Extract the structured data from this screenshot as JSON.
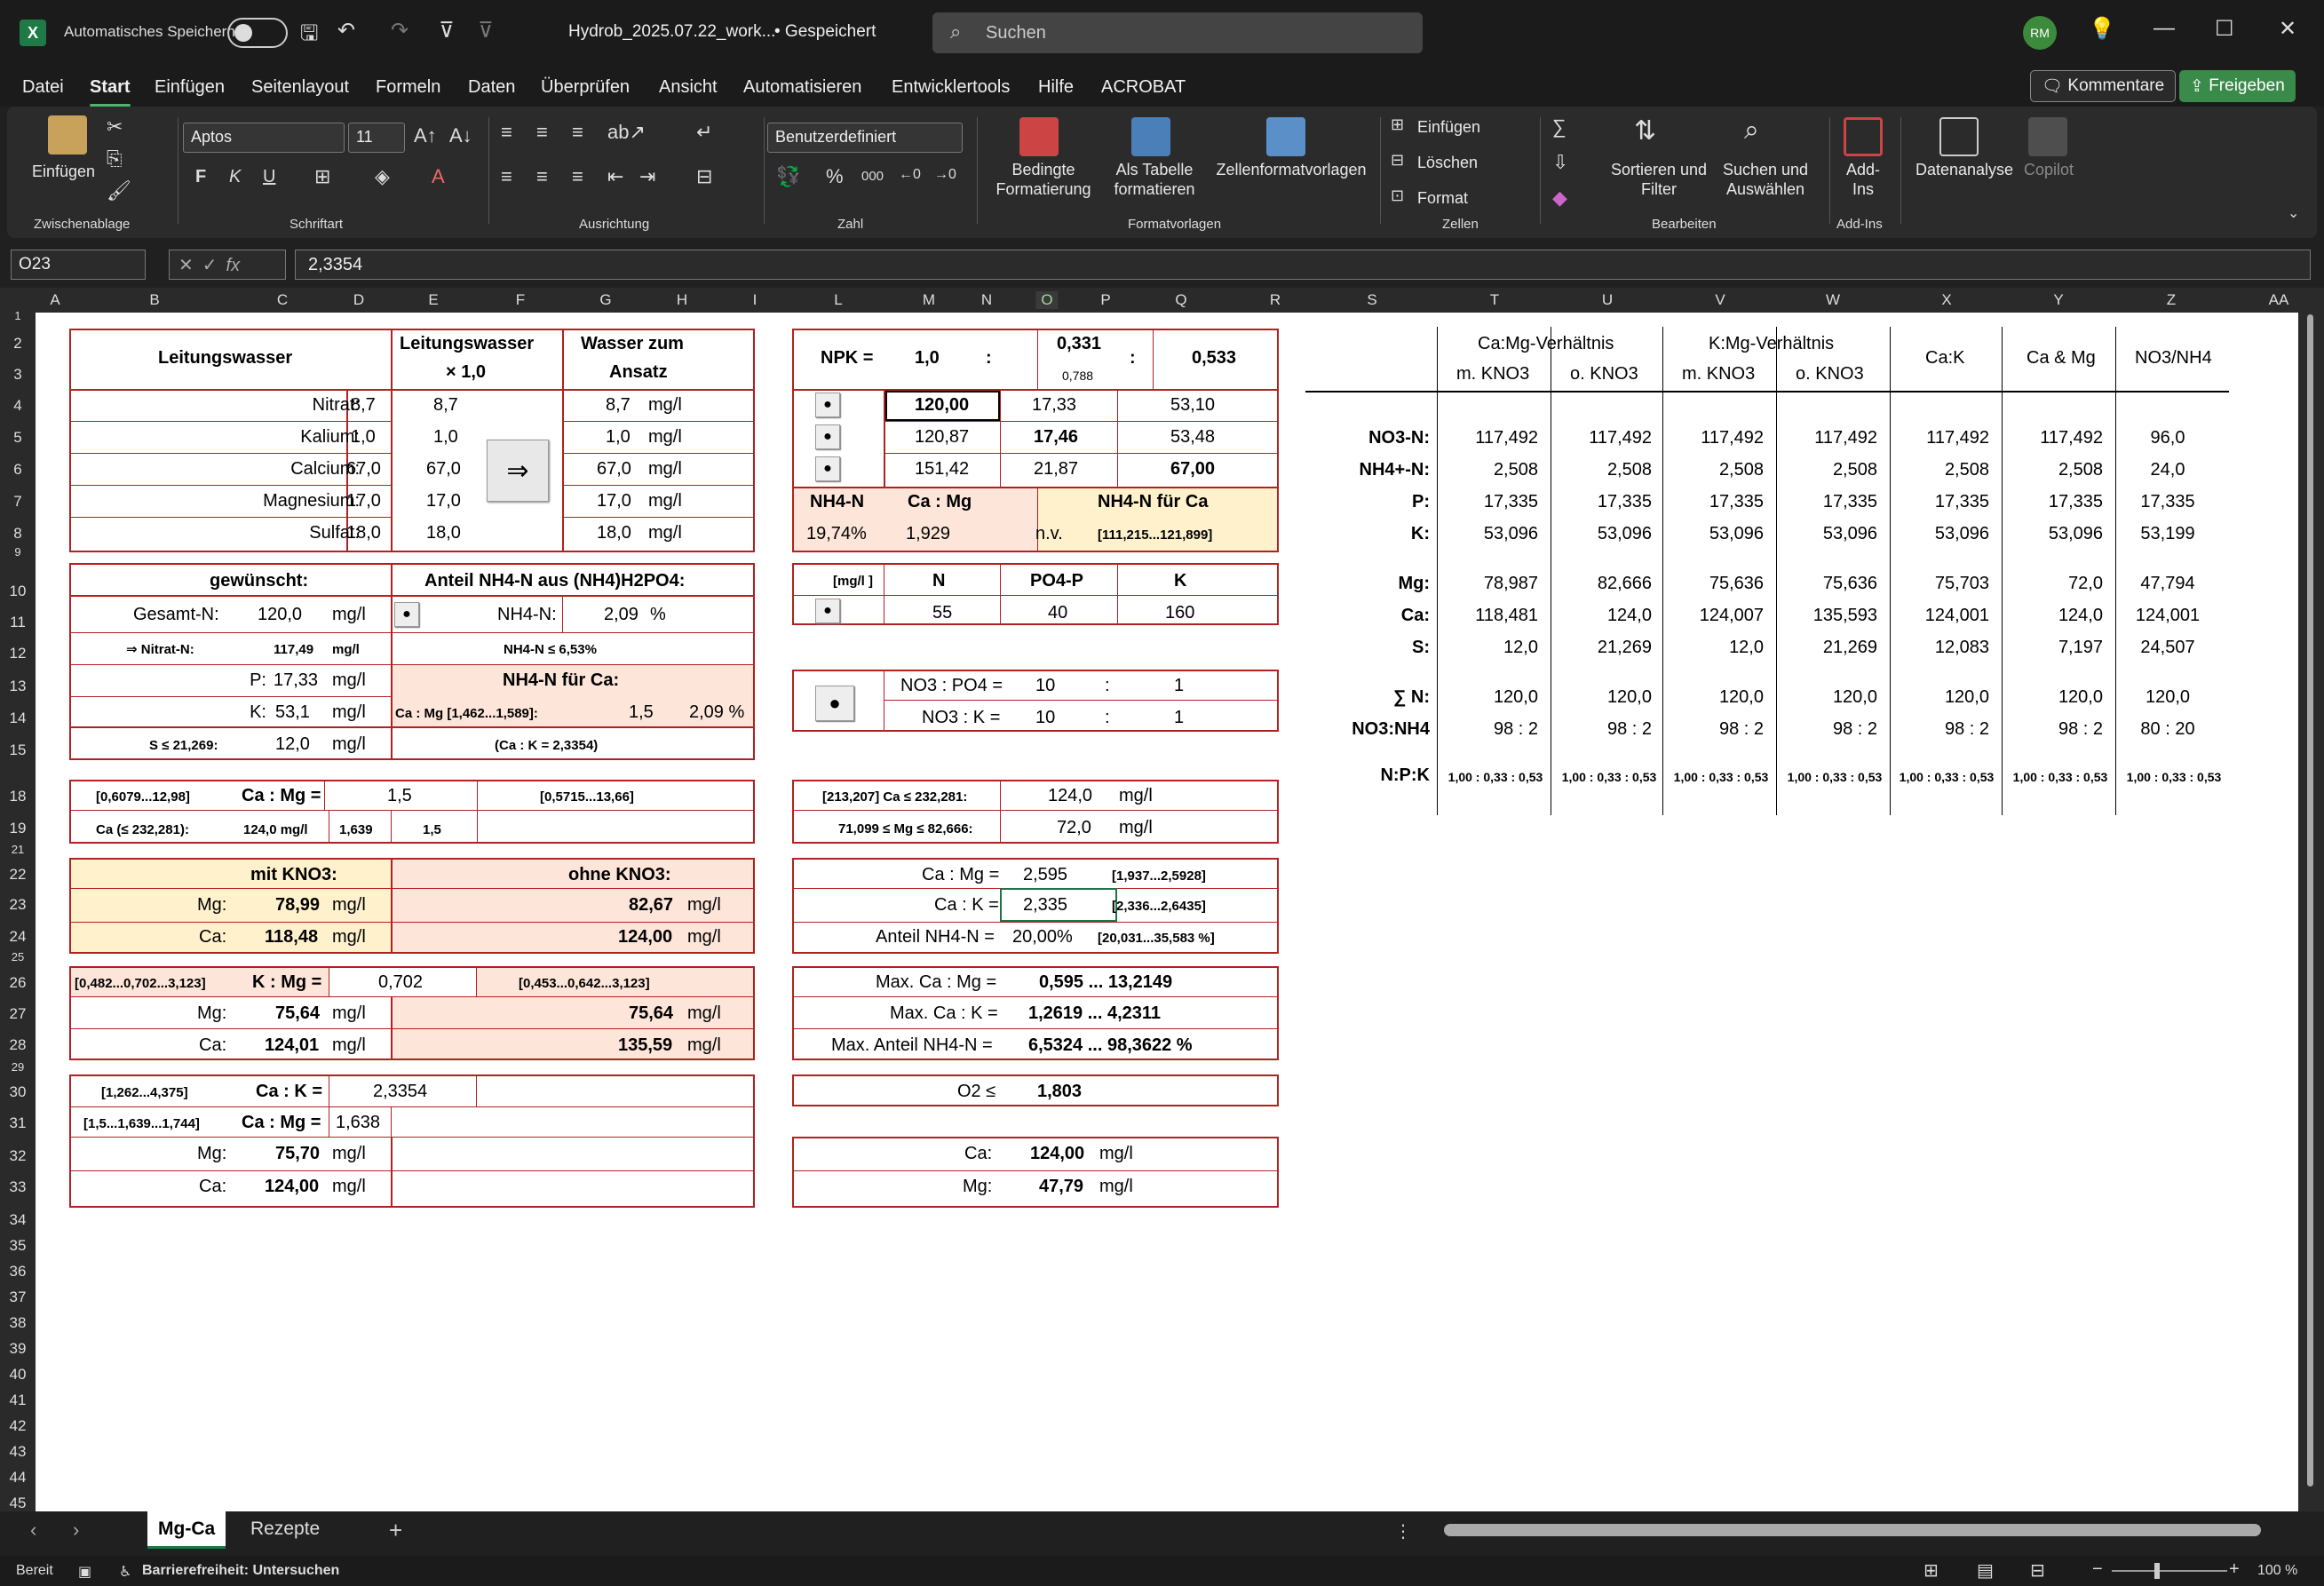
{
  "window": {
    "autosave_label": "Automatisches Speichern",
    "filename": "Hydrob_2025.07.22_work...",
    "saved": "• Gespeichert",
    "search_placeholder": "Suchen",
    "avatar": "RM"
  },
  "menu": [
    "Datei",
    "Start",
    "Einfügen",
    "Seitenlayout",
    "Formeln",
    "Daten",
    "Überprüfen",
    "Ansicht",
    "Automatisieren",
    "Entwicklertools",
    "Hilfe",
    "ACROBAT"
  ],
  "header_buttons": {
    "comments": "Kommentare",
    "share": "Freigeben"
  },
  "ribbon": {
    "einfuegen": "Einfügen",
    "font_name": "Aptos",
    "font_size": "11",
    "number_format": "Benutzerdefiniert",
    "bedingte": "Bedingte\nFormatierung",
    "als_tabelle": "Als Tabelle\nformatieren",
    "zellformat": "Zellenformatvorlagen",
    "z_einfuegen": "Einfügen",
    "z_loeschen": "Löschen",
    "z_format": "Format",
    "sortieren": "Sortieren und\nFilter",
    "suchen": "Suchen und\nAuswählen",
    "addins": "Add-\nIns",
    "datenanalyse": "Datenanalyse",
    "copilot": "Copilot",
    "groups": [
      "Zwischenablage",
      "Schriftart",
      "Ausrichtung",
      "Zahl",
      "Formatvorlagen",
      "Zellen",
      "Bearbeiten",
      "Add-Ins"
    ],
    "font_buttons": [
      "F",
      "K",
      "U"
    ]
  },
  "formula_bar": {
    "cell_ref": "O23",
    "formula": "2,3354",
    "fx": "fx"
  },
  "columns": [
    "A",
    "B",
    "C",
    "D",
    "E",
    "F",
    "G",
    "H",
    "I",
    "L",
    "M",
    "N",
    "O",
    "P",
    "Q",
    "R",
    "S",
    "T",
    "U",
    "V",
    "W",
    "X",
    "Y",
    "Z",
    "AA"
  ],
  "rows": [
    "1",
    "2",
    "3",
    "4",
    "5",
    "6",
    "7",
    "8",
    "9",
    "10",
    "11",
    "12",
    "13",
    "14",
    "15",
    "18",
    "19",
    "21",
    "22",
    "23",
    "24",
    "25",
    "26",
    "27",
    "28",
    "29",
    "30",
    "31",
    "32",
    "33",
    "34",
    "35",
    "36",
    "37",
    "38",
    "39",
    "40",
    "41",
    "42",
    "43",
    "44",
    "45"
  ],
  "b1": {
    "title": "Leitungswasser",
    "mult_title": "Leitungswasser",
    "mult": "× 1,0",
    "target": "Wasser zum",
    "target2": "Ansatz",
    "arrow": "⇒",
    "rows": [
      [
        "Nitrat:",
        "8,7",
        "8,7",
        "8,7",
        "mg/l"
      ],
      [
        "Kalium:",
        "1,0",
        "1,0",
        "1,0",
        "mg/l"
      ],
      [
        "Calcium:",
        "67,0",
        "67,0",
        "67,0",
        "mg/l"
      ],
      [
        "Magnesium:",
        "17,0",
        "17,0",
        "17,0",
        "mg/l"
      ],
      [
        "Sulfat:",
        "18,0",
        "18,0",
        "18,0",
        "mg/l"
      ]
    ]
  },
  "b2": {
    "title": "gewünscht:",
    "anteil": "Anteil NH4-N aus (NH4)H2PO4:",
    "gesamt": "Gesamt-N:",
    "gesamt_v": "120,0",
    "mgl": "mg/l",
    "nh4n": "NH4-N:",
    "nh4n_v": "2,09",
    "pct": "%",
    "nitrat": "⇒ Nitrat-N:",
    "nitrat_v": "117,49",
    "nh4le": "NH4-N ≤ 6,53%",
    "p": "P:",
    "p_v": "17,33",
    "k": "K:",
    "k_v": "53,1",
    "nh4ca": "NH4-N für Ca:",
    "camg": "Ca : Mg [1,462...1,589]:",
    "camg_v": "1,5",
    "camg_pct": "2,09 %",
    "s": "S ≤ 21,269:",
    "s_v": "12,0",
    "cak": "(Ca : K = 2,3354)",
    "dot": "●"
  },
  "b3": {
    "r1": "[0,6079...12,98]",
    "camg": "Ca : Mg =",
    "camg_v": "1,5",
    "r2": "[0,5715...13,66]",
    "ca": "Ca (≤ 232,281):",
    "ca_v": "124,0 mg/l",
    "v1": "1,639",
    "v2": "1,5"
  },
  "b4": {
    "mit": "mit KNO3:",
    "ohne": "ohne KNO3:",
    "mg": "Mg:",
    "mg_v": "78,99",
    "mg_v2": "82,67",
    "ca": "Ca:",
    "ca_v": "118,48",
    "ca_v2": "124,00",
    "mgl": "mg/l"
  },
  "b5": {
    "r1": "[0,482...0,702...3,123]",
    "kmg": "K : Mg =",
    "kmg_v": "0,702",
    "r2": "[0,453...0,642...3,123]",
    "mg": "Mg:",
    "mg_v": "75,64",
    "mg_v2": "75,64",
    "ca": "Ca:",
    "ca_v": "124,01",
    "ca_v2": "135,59",
    "mgl": "mg/l"
  },
  "b6": {
    "r1": "[1,262...4,375]",
    "cak": "Ca : K =",
    "cak_v": "2,3354",
    "r2": "[1,5...1,639...1,744]",
    "camg": "Ca : Mg =",
    "camg_v": "1,638",
    "mg": "Mg:",
    "mg_v": "75,70",
    "ca": "Ca:",
    "ca_v": "124,00",
    "mgl": "mg/l"
  },
  "npk": {
    "label": "NPK =",
    "n": "1,0",
    "colon": ":",
    "p": "0,331",
    "p_sub": "0,788",
    "k": "0,533",
    "rows": [
      [
        "120,00",
        "17,33",
        "53,10"
      ],
      [
        "120,87",
        "17,46",
        "53,48"
      ],
      [
        "151,42",
        "21,87",
        "67,00"
      ]
    ],
    "nh4": "NH4-N",
    "camg": "Ca : Mg",
    "nh4ca": "NH4-N für Ca",
    "nh4_v": "19,74%",
    "camg_v": "1,929",
    "nv": "n.v.",
    "range": "[111,215...121,899]",
    "dot": "●"
  },
  "nk": {
    "unit": "[mg/l ]",
    "n": "N",
    "p": "PO4-P",
    "k": "K",
    "n_v": "55",
    "p_v": "40",
    "k_v": "160",
    "dot": "●"
  },
  "ratio": {
    "no3po4": "NO3 : PO4 =",
    "no3po4_v": "10",
    "no3po4_r": "1",
    "no3k": "NO3 : K =",
    "no3k_v": "10",
    "no3k_r": "1",
    "colon": ":",
    "dot": "●"
  },
  "limits": {
    "ca": "[213,207] Ca ≤ 232,281:",
    "ca_v": "124,0",
    "mg": "71,099 ≤ Mg ≤ 82,666:",
    "mg_v": "72,0",
    "mgl": "mg/l"
  },
  "sel": {
    "camg": "Ca : Mg =",
    "camg_v": "2,595",
    "camg_r": "[1,937...2,5928]",
    "cak": "Ca : K =",
    "cak_v": "2,335",
    "cak_r": "[2,336...2,6435]",
    "nh4": "Anteil NH4-N =",
    "nh4_v": "20,00%",
    "nh4_r": "[20,031...35,583 %]"
  },
  "max": {
    "camg": "Max. Ca : Mg =",
    "camg_v": "0,595 ... 13,2149",
    "cak": "Max. Ca : K =",
    "cak_v": "1,2619 ... 4,2311",
    "nh4": "Max. Anteil NH4-N =",
    "nh4_v": "6,5324 ... 98,3622 %"
  },
  "o2": {
    "label": "O2 ≤",
    "value": "1,803"
  },
  "final": {
    "ca": "Ca:",
    "ca_v": "124,00",
    "mg": "Mg:",
    "mg_v": "47,79",
    "mgl": "mg/l"
  },
  "table": {
    "h1": [
      "Ca:Mg-Verhältnis",
      "K:Mg-Verhältnis",
      "Ca:K",
      "Ca & Mg",
      "NO3/NH4"
    ],
    "h2": [
      "m. KNO3",
      "o. KNO3",
      "m. KNO3",
      "o. KNO3"
    ],
    "labels": [
      "NO3-N:",
      "NH4+-N:",
      "P:",
      "K:",
      "Mg:",
      "Ca:",
      "S:",
      "∑ N:",
      "NO3:NH4",
      "N:P:K"
    ],
    "data": [
      [
        "117,492",
        "117,492",
        "117,492",
        "117,492",
        "117,492",
        "117,492",
        "96,0"
      ],
      [
        "2,508",
        "2,508",
        "2,508",
        "2,508",
        "2,508",
        "2,508",
        "24,0"
      ],
      [
        "17,335",
        "17,335",
        "17,335",
        "17,335",
        "17,335",
        "17,335",
        "17,335"
      ],
      [
        "53,096",
        "53,096",
        "53,096",
        "53,096",
        "53,096",
        "53,096",
        "53,199"
      ],
      [
        "78,987",
        "82,666",
        "75,636",
        "75,636",
        "75,703",
        "72,0",
        "47,794"
      ],
      [
        "118,481",
        "124,0",
        "124,007",
        "135,593",
        "124,001",
        "124,0",
        "124,001"
      ],
      [
        "12,0",
        "21,269",
        "12,0",
        "21,269",
        "12,083",
        "7,197",
        "24,507"
      ],
      [
        "120,0",
        "120,0",
        "120,0",
        "120,0",
        "120,0",
        "120,0",
        "120,0"
      ],
      [
        "98 : 2",
        "98 : 2",
        "98 : 2",
        "98 : 2",
        "98 : 2",
        "98 : 2",
        "80 : 20"
      ],
      [
        "1,00 : 0,33 : 0,53",
        "1,00 : 0,33 : 0,53",
        "1,00 : 0,33 : 0,53",
        "1,00 : 0,33 : 0,53",
        "1,00 : 0,33 : 0,53",
        "1,00 : 0,33 : 0,53",
        "1,00 : 0,33 : 0,53"
      ]
    ]
  },
  "tabs": [
    "Mg-Ca",
    "Rezepte"
  ],
  "status": {
    "ready": "Bereit",
    "accessibility": "Barrierefreiheit: Untersuchen",
    "zoom": "100 %"
  }
}
